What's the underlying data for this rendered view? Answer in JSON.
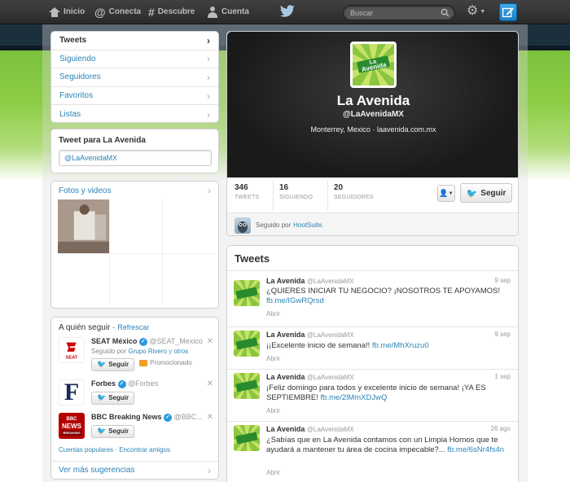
{
  "topbar": {
    "home_label": "Inicio",
    "connect_label": "Conecta",
    "discover_label": "Descubre",
    "account_label": "Cuenta",
    "search_placeholder": "Buscar"
  },
  "sidebar_nav": {
    "items": [
      {
        "label": "Tweets"
      },
      {
        "label": "Siguiendo"
      },
      {
        "label": "Seguidores"
      },
      {
        "label": "Favoritos"
      },
      {
        "label": "Listas"
      }
    ]
  },
  "tweet_to": {
    "title": "Tweet para La Avenida",
    "value": "@LaAvenidaMX"
  },
  "photos": {
    "title": "Fotos y videos"
  },
  "who_to_follow": {
    "title": "A quién seguir",
    "refresh_label": "Refrescar",
    "accounts": [
      {
        "name": "SEAT México",
        "handle": "@SEAT_Mexico",
        "followed_by_prefix": "Seguido por",
        "followed_by_link1": "Grupo Rivero",
        "followed_by_and": "y",
        "followed_by_link2": "otros",
        "follow_label": "Seguir",
        "promoted_label": "Promocionado",
        "logo_text": "SEAT"
      },
      {
        "name": "Forbes",
        "handle": "@Forbes",
        "follow_label": "Seguir",
        "logo_text": "F"
      },
      {
        "name": "BBC Breaking News",
        "handle": "@BBC...",
        "follow_label": "Seguir",
        "logo_line1": "BBC",
        "logo_line2": "NEWS",
        "logo_line3": "BREAKING"
      }
    ],
    "links": "Cuentas populares · Encontrar amigos",
    "more_label": "Ver más sugerencias"
  },
  "profile": {
    "name": "La Avenida",
    "handle": "@LaAvenidaMX",
    "location": "Monterrey, Mexico",
    "separator": "·",
    "url": "laavenida.com.mx",
    "avatar_line1": "La",
    "avatar_line2": "Avenida",
    "stats": [
      {
        "value": "346",
        "label": "TWEETS"
      },
      {
        "value": "16",
        "label": "SIGUIENDO"
      },
      {
        "value": "20",
        "label": "SEGUIDORES"
      }
    ],
    "follow_label": "Seguir",
    "followed_by_prefix": "Seguido por",
    "followed_by_link": "HootSuite."
  },
  "tweets": {
    "title": "Tweets",
    "items": [
      {
        "name": "La Avenida",
        "handle": "@LaAvenidaMX",
        "time": "9 sep",
        "text": "¿QUIERES INICIAR TU NEGOCIO? ¡NOSOTROS TE APOYAMOS!",
        "link": "fb.me/IGwRQrsd",
        "expand": "Abrir"
      },
      {
        "name": "La Avenida",
        "handle": "@LaAvenidaMX",
        "time": "9 sep",
        "text": "¡¡Excelente inicio de semana!!",
        "link": "fb.me/MhXruzu0",
        "expand": "Abrir"
      },
      {
        "name": "La Avenida",
        "handle": "@LaAvenidaMX",
        "time": "1 sep",
        "text": "¡Feliz domingo para todos y excelente inicio de semana! ¡YA ES SEPTIEMBRE!",
        "link": "fb.me/2lMmXDJwQ",
        "expand": "Abrir"
      },
      {
        "name": "La Avenida",
        "handle": "@LaAvenidaMX",
        "time": "26 ago",
        "text": "¿Sabías que en La Avenida contamos con un Limpia Hornos que te ayudará a mantener tu área de cocina impecable?...",
        "link": "fb.me/6sNr4fs4n",
        "expand": "Abrir"
      }
    ]
  },
  "colors": {
    "link": "#2a84b6",
    "brand_green": "#7cc23c",
    "twitter_blue": "#2a9ae0"
  }
}
